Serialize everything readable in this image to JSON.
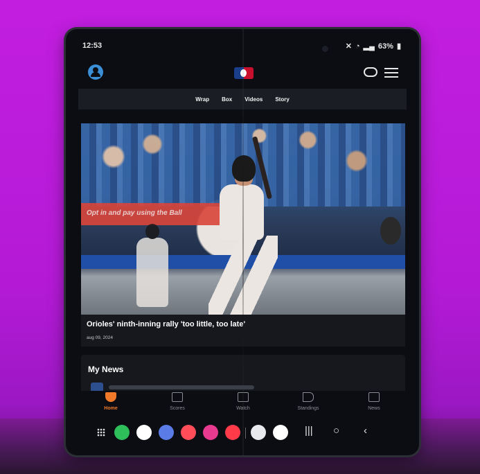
{
  "status_bar": {
    "time": "12:53",
    "battery": "63%"
  },
  "tabs": [
    "Wrap",
    "Box",
    "Videos",
    "Story"
  ],
  "hero": {
    "banner_text": "Opt in and pay using the Ball",
    "headline": "Orioles' ninth-inning rally 'too little, too late'",
    "date": "aug 09, 2024"
  },
  "my_news": {
    "title": "My News"
  },
  "bottom_nav": [
    {
      "label": "Home",
      "icon": "home-plate-icon",
      "active": true
    },
    {
      "label": "Scores",
      "icon": "scoreboard-icon",
      "active": false
    },
    {
      "label": "Watch",
      "icon": "play-screen-icon",
      "active": false
    },
    {
      "label": "Standings",
      "icon": "flag-icon",
      "active": false
    },
    {
      "label": "News",
      "icon": "newspaper-icon",
      "active": false
    }
  ],
  "dock_apps": [
    {
      "name": "phone-app-icon",
      "color": "#2fbf5a"
    },
    {
      "name": "messages-app-icon",
      "color": "#ffffff"
    },
    {
      "name": "samsung-internet-icon",
      "color": "#5b7be6"
    },
    {
      "name": "gallery-app-icon",
      "color": "#ff4d5a"
    },
    {
      "name": "galaxy-store-icon",
      "color": "#e83b8f"
    },
    {
      "name": "youtube-app-icon",
      "color": "#ff3b4a"
    },
    {
      "name": "chrome-app-icon",
      "color": "#e8eaed"
    },
    {
      "name": "google-app-icon",
      "color": "#ffffff"
    }
  ],
  "colors": {
    "accent": "#f07a2a",
    "background": "#c21ee0"
  }
}
